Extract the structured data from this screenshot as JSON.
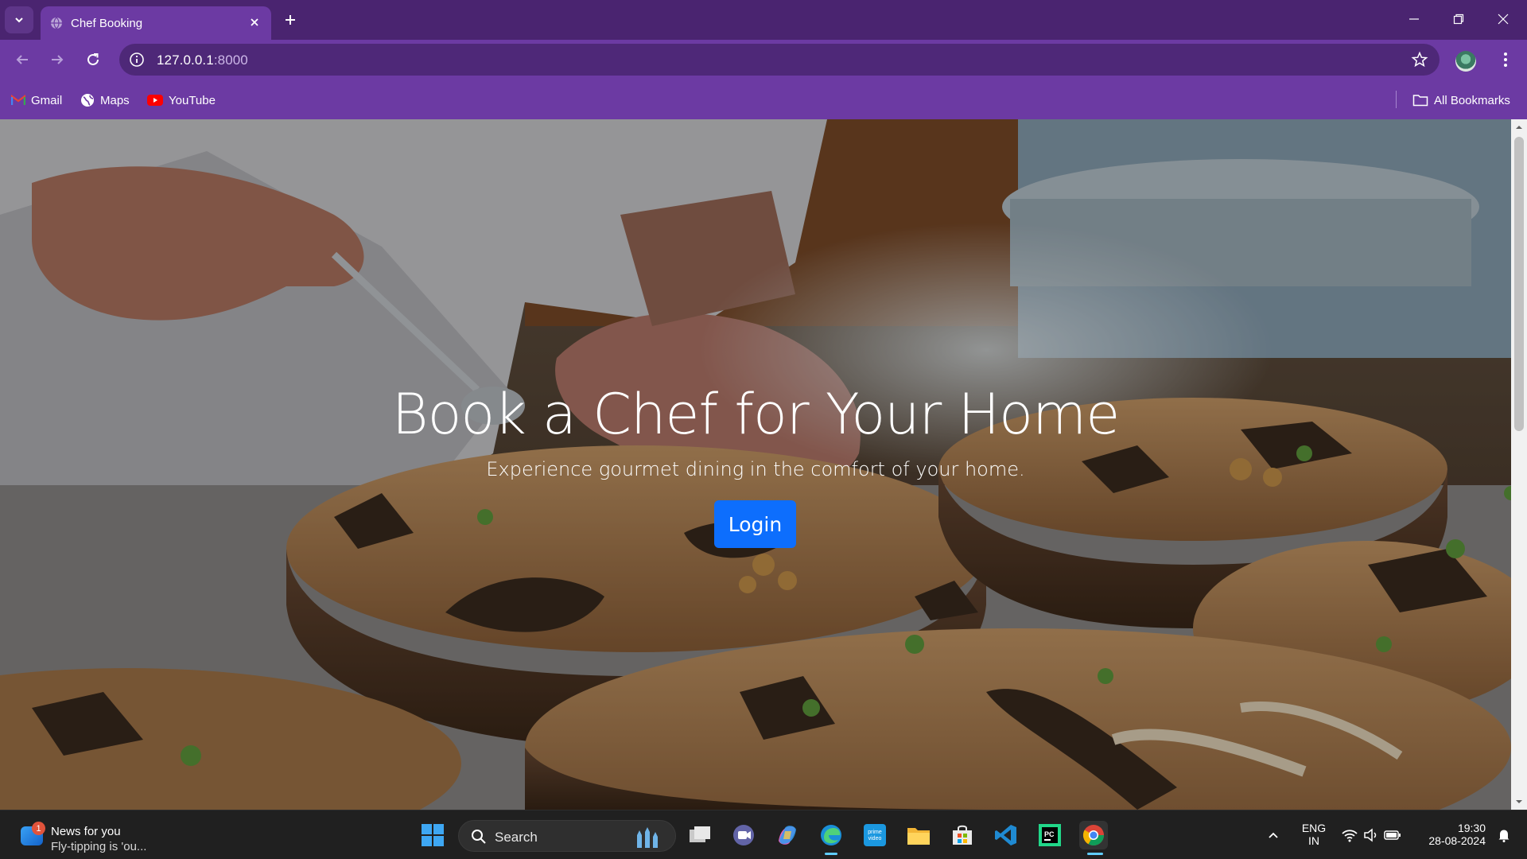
{
  "browser": {
    "tab": {
      "title": "Chef Booking"
    },
    "address": {
      "host": "127.0.0.1",
      "port": ":8000"
    },
    "bookmarks": [
      {
        "label": "Gmail",
        "icon": "gmail-icon"
      },
      {
        "label": "Maps",
        "icon": "maps-icon"
      },
      {
        "label": "YouTube",
        "icon": "youtube-icon"
      }
    ],
    "all_bookmarks_label": "All Bookmarks",
    "colors": {
      "tab_strip": "#4a2470",
      "toolbar": "#6c3aa3"
    }
  },
  "page": {
    "hero": {
      "title": "Book a Chef for Your Home",
      "subtitle": "Experience gourmet dining in the comfort of your home.",
      "login_label": "Login"
    },
    "colors": {
      "primary_button": "#0d6efd"
    }
  },
  "taskbar": {
    "news": {
      "badge": "1",
      "title": "News for you",
      "subtitle": "Fly-tipping is 'ou..."
    },
    "search_label": "Search",
    "apps": [
      "start-icon",
      "search-icon",
      "task-view-icon",
      "teams-icon",
      "copilot-icon",
      "edge-icon",
      "prime-video-icon",
      "file-explorer-icon",
      "microsoft-store-icon",
      "vscode-icon",
      "pycharm-icon",
      "chrome-icon"
    ],
    "tray": {
      "language_line1": "ENG",
      "language_line2": "IN",
      "time": "19:30",
      "date": "28-08-2024"
    }
  }
}
